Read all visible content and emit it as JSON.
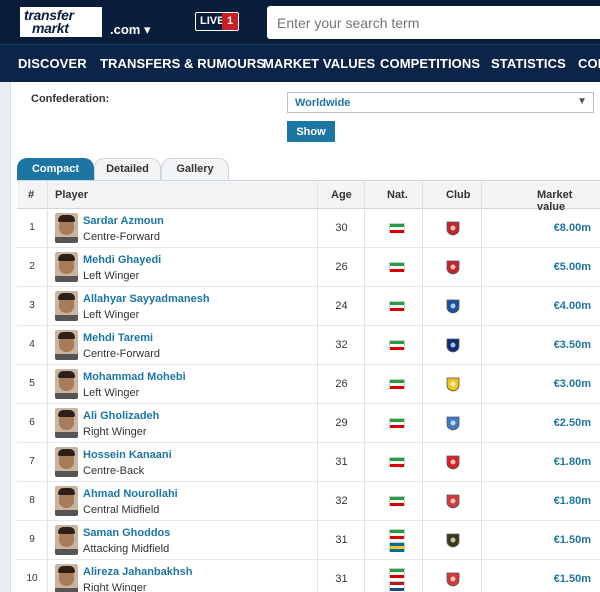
{
  "header": {
    "logo_line1": "transfer",
    "logo_line2": "markt",
    "domain": ".com ▾",
    "live_label": "LIVE",
    "live_count": "1",
    "search_placeholder": "Enter your search term"
  },
  "nav": [
    "DISCOVER",
    "TRANSFERS & RUMOURS",
    "MARKET VALUES",
    "COMPETITIONS",
    "STATISTICS",
    "COM"
  ],
  "filter": {
    "confederation_label": "Confederation:",
    "confederation_value": "Worldwide",
    "show_label": "Show"
  },
  "tabs": [
    "Compact",
    "Detailed",
    "Gallery"
  ],
  "table": {
    "headers": [
      "#",
      "Player",
      "Age",
      "Nat.",
      "Club",
      "Market value"
    ],
    "rows": [
      {
        "rank": "1",
        "name": "Sardar Azmoun",
        "position": "Centre-Forward",
        "age": "30",
        "nat": [
          "iran"
        ],
        "club_color": "#c2252d",
        "value": "€8.00m"
      },
      {
        "rank": "2",
        "name": "Mehdi Ghayedi",
        "position": "Left Winger",
        "age": "26",
        "nat": [
          "iran"
        ],
        "club_color": "#c2252d",
        "value": "€5.00m"
      },
      {
        "rank": "3",
        "name": "Allahyar Sayyadmanesh",
        "position": "Left Winger",
        "age": "24",
        "nat": [
          "iran"
        ],
        "club_color": "#1a4fa0",
        "value": "€4.00m"
      },
      {
        "rank": "4",
        "name": "Mehdi Taremi",
        "position": "Centre-Forward",
        "age": "32",
        "nat": [
          "iran"
        ],
        "club_color": "#0b2a7a",
        "value": "€3.50m"
      },
      {
        "rank": "5",
        "name": "Mohammad Mohebi",
        "position": "Left Winger",
        "age": "26",
        "nat": [
          "iran"
        ],
        "club_color": "#f0c419",
        "value": "€3.00m"
      },
      {
        "rank": "6",
        "name": "Ali Gholizadeh",
        "position": "Right Winger",
        "age": "29",
        "nat": [
          "iran"
        ],
        "club_color": "#3c7bc4",
        "value": "€2.50m"
      },
      {
        "rank": "7",
        "name": "Hossein Kanaani",
        "position": "Centre-Back",
        "age": "31",
        "nat": [
          "iran"
        ],
        "club_color": "#d4242a",
        "value": "€1.80m"
      },
      {
        "rank": "8",
        "name": "Ahmad Nourollahi",
        "position": "Central Midfield",
        "age": "32",
        "nat": [
          "iran"
        ],
        "club_color": "#d33a3a",
        "value": "€1.80m"
      },
      {
        "rank": "9",
        "name": "Saman Ghoddos",
        "position": "Attacking Midfield",
        "age": "31",
        "nat": [
          "iran",
          "sweden"
        ],
        "club_color": "#3a3a1a",
        "value": "€1.50m"
      },
      {
        "rank": "10",
        "name": "Alireza Jahanbakhsh",
        "position": "Right Winger",
        "age": "31",
        "nat": [
          "iran",
          "netherlands"
        ],
        "club_color": "#d33a3a",
        "value": "€1.50m"
      }
    ]
  }
}
